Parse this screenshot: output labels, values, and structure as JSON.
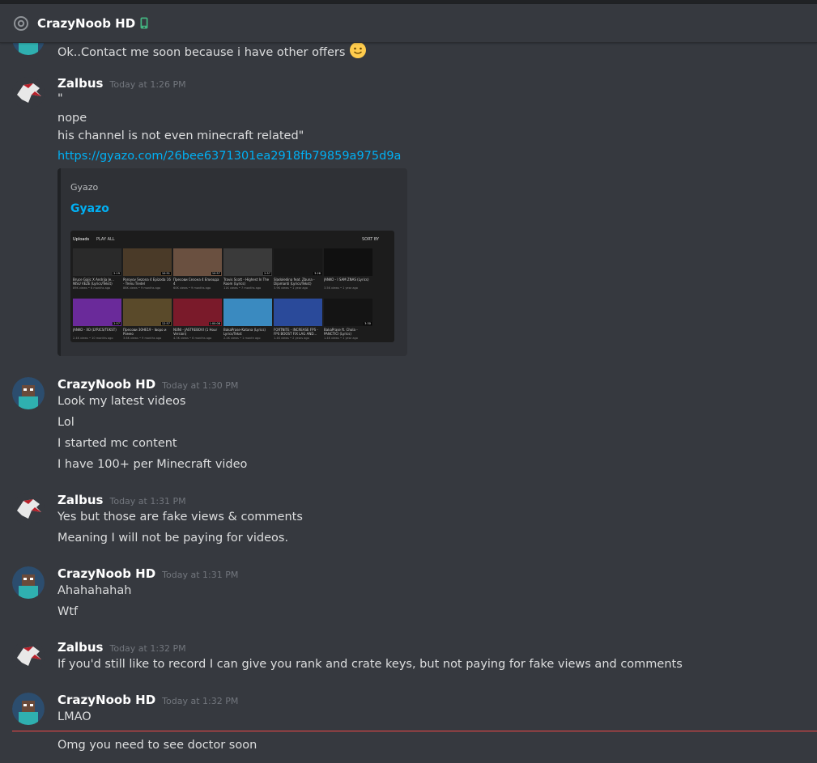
{
  "header": {
    "channel_name": "CrazyNoob HD"
  },
  "messages": [
    {
      "lines": [
        "Ok..Contact me soon because i have other offers"
      ]
    },
    {
      "author": "Zalbus",
      "timestamp": "Today at 1:26 PM",
      "lines": [
        "\"",
        "nope",
        "his channel is not even minecraft related\""
      ],
      "link": "https://gyazo.com/26bee6371301ea2918fb79859a975d9a",
      "embed": {
        "provider": "Gyazo",
        "title": "Gyazo",
        "screenshot": {
          "tab_uploads": "Uploads",
          "tab_play_all": "PLAY ALL",
          "sort_by": "SORT BY",
          "videos": [
            {
              "caption": "Bruce Gajic X Andrija Je... NISU VEZE (Lyrics/Tekst)",
              "meta": "89K views • 6 months ago",
              "duration": "2:19",
              "color": "#2a2a2a"
            },
            {
              "caption": "Poroyov Sezona 4 Epizoda 16 - Trenu Tiedel",
              "meta": "86K views • 9 months ago",
              "duration": "10:51",
              "color": "#4a3a28"
            },
            {
              "caption": "Пресови Сезона 4 Епизода 4",
              "meta": "60K views • 9 months ago",
              "duration": "10:57",
              "color": "#6a5040"
            },
            {
              "caption": "Travis Scott - Highest In The Room (Lyrics)",
              "meta": "11K views • 7 months ago",
              "duration": "2:57",
              "color": "#3a3a3a"
            },
            {
              "caption": "Sladoledina feat. Zbuna - Dijamanti (Lyrics/Tekst)",
              "meta": "3.9K views • 1 year ago",
              "duration": "3:26",
              "color": "#181818"
            },
            {
              "caption": "JANKO - I SAM ZNAS (Lyrics)",
              "meta": "3.5K views • 1 year ago",
              "duration": "",
              "color": "#101010"
            },
            {
              "caption": "JANKO - XO (LYRICS/TEKST)",
              "meta": "2.4K views • 10 months ago",
              "duration": "2:57",
              "color": "#6a2a9a"
            },
            {
              "caption": "Пресови 30НЕ19 - Іворо и Ромео",
              "meta": "3.6K views • 9 months ago",
              "duration": "12:57",
              "color": "#5a4a2a"
            },
            {
              "caption": "NUNI - JASTREBOVI (1 Hour Version)",
              "meta": "4.3K views • 6 months ago",
              "duration": "1:00:08",
              "color": "#7a1a2a"
            },
            {
              "caption": "BakaPrase-Katana (Lyrics) Lyrics/Tekst",
              "meta": "2.4K views • 1 month ago",
              "duration": "",
              "color": "#3a8ac0"
            },
            {
              "caption": "FORTNITE - INCREASE FPS - FPS BOOST FIX LAG AND...",
              "meta": "1.4K views • 2 years ago",
              "duration": "",
              "color": "#2a4a9a"
            },
            {
              "caption": "BakaPrase ft. Chola - PANCTIČI (Lyrics)",
              "meta": "1.4K views • 1 year ago",
              "duration": "3:30",
              "color": "#141414"
            }
          ]
        }
      }
    },
    {
      "author": "CrazyNoob HD",
      "timestamp": "Today at 1:30 PM",
      "lines": [
        "Look my latest videos",
        "Lol",
        "I started mc content",
        "I have 100+ per Minecraft video"
      ]
    },
    {
      "author": "Zalbus",
      "timestamp": "Today at 1:31 PM",
      "lines": [
        "Yes but those are fake views & comments",
        "Meaning I will not be paying for videos."
      ]
    },
    {
      "author": "CrazyNoob HD",
      "timestamp": "Today at 1:31 PM",
      "lines": [
        "Ahahahahah",
        "Wtf"
      ]
    },
    {
      "author": "Zalbus",
      "timestamp": "Today at 1:32 PM",
      "lines": [
        "If you'd still like to record I can give you rank and crate keys, but not paying for fake views and comments"
      ]
    },
    {
      "author": "CrazyNoob HD",
      "timestamp": "Today at 1:32 PM",
      "lines": [
        "LMAO",
        "Omg you need to see doctor soon"
      ]
    }
  ],
  "colors": {
    "background": "#36393f",
    "link": "#00b0f4",
    "new_messages_divider": "#f04747",
    "timestamp": "#72767d"
  }
}
